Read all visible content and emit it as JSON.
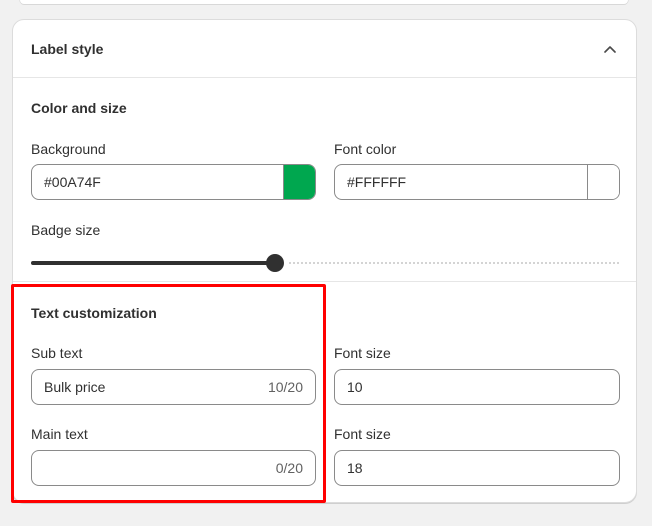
{
  "card": {
    "title": "Label style"
  },
  "color_and_size": {
    "title": "Color and size",
    "background": {
      "label": "Background",
      "value": "#00A74F",
      "swatch_color": "#00A74F"
    },
    "font_color": {
      "label": "Font color",
      "value": "#FFFFFF",
      "swatch_color": "#FFFFFF"
    },
    "badge_size": {
      "label": "Badge size",
      "fraction": 0.4
    }
  },
  "text_customization": {
    "title": "Text customization",
    "sub_text": {
      "label": "Sub text",
      "value": "Bulk price",
      "count": "10/20"
    },
    "sub_font_size": {
      "label": "Font size",
      "value": "10"
    },
    "main_text": {
      "label": "Main text",
      "value": "",
      "count": "0/20"
    },
    "main_font_size": {
      "label": "Font size",
      "value": "18"
    }
  },
  "colors": {
    "highlight": "#FF0000"
  }
}
